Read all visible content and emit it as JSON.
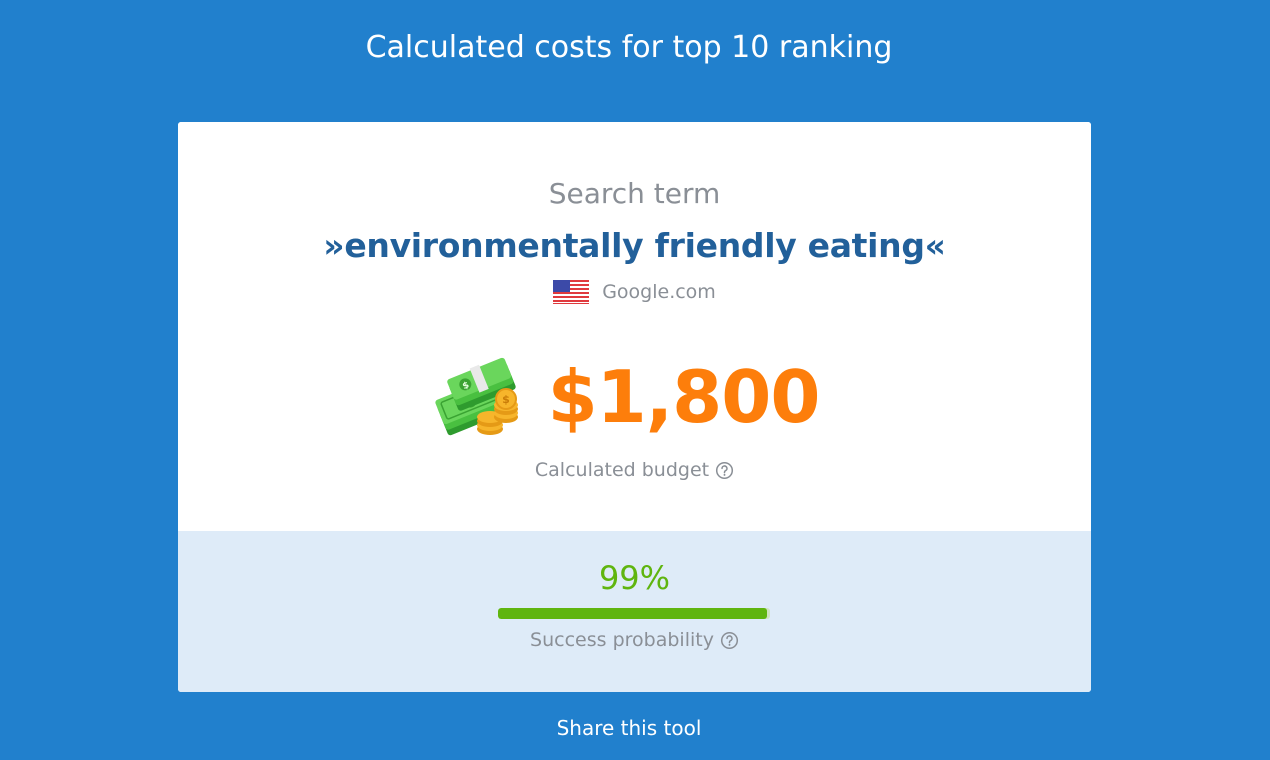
{
  "page": {
    "title": "Calculated costs for top 10 ranking"
  },
  "card": {
    "search_term_label": "Search term",
    "keyword": "»environmentally friendly eating«",
    "engine": {
      "flag_icon": "us-flag-icon",
      "name": "Google.com"
    },
    "budget": {
      "icon": "money-stack-icon",
      "amount": "$1,800",
      "label": "Calculated budget"
    },
    "probability": {
      "value_text": "99%",
      "value": 0.99,
      "label": "Success probability"
    }
  },
  "footer": {
    "share_label": "Share this tool"
  },
  "colors": {
    "background": "#2180cd",
    "keyword": "#22609a",
    "budget": "#fd7e0b",
    "success": "#5fb50f",
    "panel": "#deebf8"
  }
}
